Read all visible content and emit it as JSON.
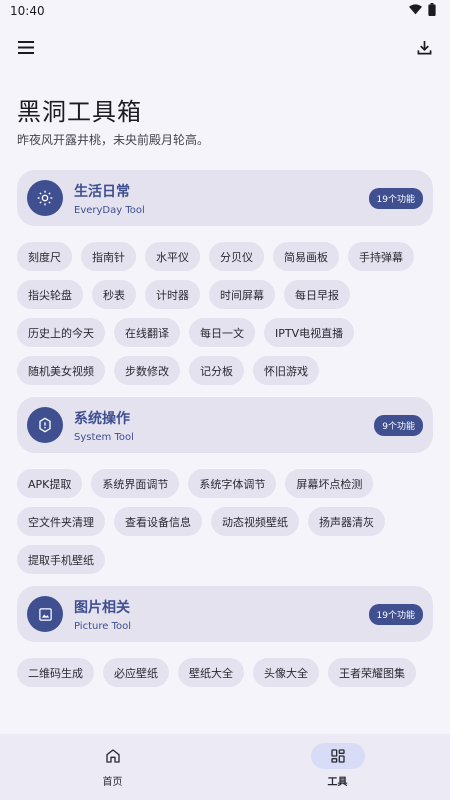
{
  "status_bar": {
    "time": "10:40"
  },
  "header": {
    "title": "黑洞工具箱",
    "subtitle": "昨夜风开露井桃，未央前殿月轮高。"
  },
  "sections": [
    {
      "title": "生活日常",
      "subtitle": "EveryDay Tool",
      "count": "19个功能",
      "icon": "sun-icon",
      "items": [
        "刻度尺",
        "指南针",
        "水平仪",
        "分贝仪",
        "简易画板",
        "手持弹幕",
        "指尖轮盘",
        "秒表",
        "计时器",
        "时间屏幕",
        "每日早报",
        "历史上的今天",
        "在线翻译",
        "每日一文",
        "IPTV电视直播",
        "随机美女视频",
        "步数修改",
        "记分板",
        "怀旧游戏"
      ]
    },
    {
      "title": "系统操作",
      "subtitle": "System Tool",
      "count": "9个功能",
      "icon": "settings-icon",
      "items": [
        "APK提取",
        "系统界面调节",
        "系统字体调节",
        "屏幕坏点检测",
        "空文件夹清理",
        "查看设备信息",
        "动态视频壁纸",
        "扬声器清灰",
        "提取手机壁纸"
      ]
    },
    {
      "title": "图片相关",
      "subtitle": "Picture Tool",
      "count": "19个功能",
      "icon": "image-icon",
      "items": [
        "二维码生成",
        "必应壁纸",
        "壁纸大全",
        "头像大全",
        "王者荣耀图集"
      ]
    }
  ],
  "bottom_nav": [
    {
      "label": "首页",
      "icon": "home-icon",
      "active": false
    },
    {
      "label": "工具",
      "icon": "grid-icon",
      "active": true
    }
  ],
  "colors": {
    "accent": "#3f4f90",
    "surface": "#e3e2ee",
    "background": "#f6f4fb"
  }
}
